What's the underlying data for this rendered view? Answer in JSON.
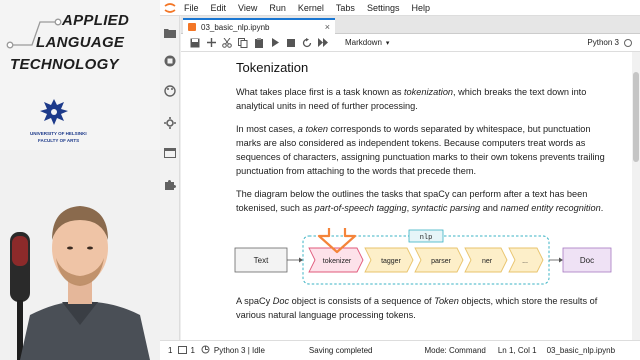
{
  "branding": {
    "line1": "APPLIED",
    "line2": "LANGUAGE",
    "line3": "TECHNOLOGY",
    "university": "UNIVERSITY OF HELSINKI",
    "faculty": "FACULTY OF ARTS"
  },
  "menu": [
    "File",
    "Edit",
    "View",
    "Run",
    "Kernel",
    "Tabs",
    "Settings",
    "Help"
  ],
  "tab": {
    "title": "03_basic_nlp.ipynb",
    "close": "×"
  },
  "toolbar": {
    "cell_type": "Markdown",
    "kernel": "Python 3"
  },
  "notebook": {
    "heading": "Tokenization",
    "p1": [
      {
        "t": "What takes place first is a task known as "
      },
      {
        "t": "tokenization",
        "i": true
      },
      {
        "t": ", which breaks the text down into analytical units in need of further processing."
      }
    ],
    "p2": [
      {
        "t": "In most cases, "
      },
      {
        "t": "a token",
        "i": true
      },
      {
        "t": " corresponds to words separated by whitespace, but punctuation marks are also considered as independent tokens. Because computers treat words as sequences of characters, assigning punctuation marks to their own tokens prevents trailing punctuation from attaching to the words that precede them."
      }
    ],
    "p3": [
      {
        "t": "The diagram below the outlines the tasks that spaCy can perform after a text has been tokenised, such as "
      },
      {
        "t": "part-of-speech tagging",
        "i": true
      },
      {
        "t": ", "
      },
      {
        "t": "syntactic parsing",
        "i": true
      },
      {
        "t": " and "
      },
      {
        "t": "named entity recognition",
        "i": true
      },
      {
        "t": "."
      }
    ],
    "p4": [
      {
        "t": "A spaCy "
      },
      {
        "t": "Doc",
        "i": true
      },
      {
        "t": " object is consists of a sequence of "
      },
      {
        "t": "Token",
        "i": true
      },
      {
        "t": " objects, which store the results of various natural language processing tokens."
      }
    ]
  },
  "diagram": {
    "input": "Text",
    "pipeline_label": "nlp",
    "steps": [
      "tokenizer",
      "tagger",
      "parser",
      "ner",
      "..."
    ],
    "output": "Doc"
  },
  "status": {
    "cells": "1",
    "terminals": "1",
    "kernel": "Python 3 | Idle",
    "save": "Saving completed",
    "mode": "Mode: Command",
    "position": "Ln 1, Col 1",
    "file": "03_basic_nlp.ipynb"
  },
  "colors": {
    "jupyter_orange": "#f37626",
    "tokenizer_fill": "#fde2ea",
    "tokenizer_stroke": "#e0587a",
    "step_fill": "#fdefc9",
    "step_stroke": "#e8c36b",
    "pipeline_border": "#3bb3c4",
    "doc_fill": "#efe2f5",
    "doc_stroke": "#a678c2",
    "arrow": "#f4843a"
  },
  "icons": [
    "jupyter-logo-icon",
    "folder-icon",
    "stop-circle-icon",
    "palette-icon",
    "wrench-icon",
    "tab-icon",
    "puzzle-icon",
    "save-icon",
    "plus-icon",
    "cut-icon",
    "copy-icon",
    "paste-icon",
    "run-icon",
    "stop-icon",
    "restart-icon",
    "fast-forward-icon"
  ]
}
